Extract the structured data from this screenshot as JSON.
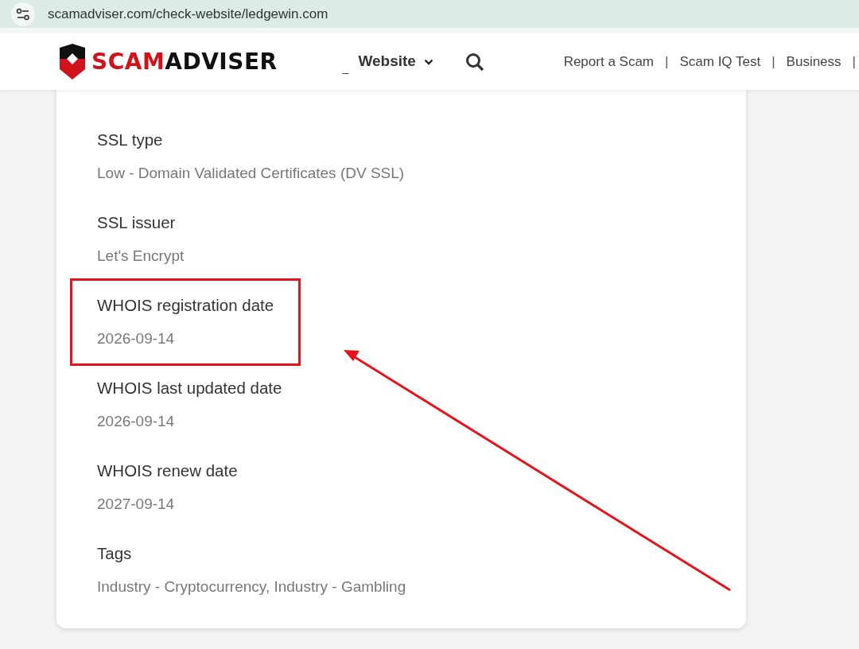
{
  "browser": {
    "url": "scamadviser.com/check-website/ledgewin.com"
  },
  "header": {
    "logo": {
      "accent": "SCAM",
      "rest": "ADVISER"
    },
    "marker": "_",
    "menu": {
      "label": "Website"
    },
    "links": [
      "Report a Scam",
      "Scam IQ Test",
      "Business"
    ],
    "separator": "|"
  },
  "details": [
    {
      "label": "SSL type",
      "value": "Low - Domain Validated Certificates (DV SSL)",
      "highlighted": false
    },
    {
      "label": "SSL issuer",
      "value": "Let's Encrypt",
      "highlighted": false
    },
    {
      "label": "WHOIS registration date",
      "value": "2026-09-14",
      "highlighted": true
    },
    {
      "label": "WHOIS last updated date",
      "value": "2026-09-14",
      "highlighted": false
    },
    {
      "label": "WHOIS renew date",
      "value": "2027-09-14",
      "highlighted": false
    },
    {
      "label": "Tags",
      "value": "Industry - Cryptocurrency, Industry - Gambling",
      "highlighted": false
    }
  ],
  "annotation": {
    "arrow": true
  }
}
